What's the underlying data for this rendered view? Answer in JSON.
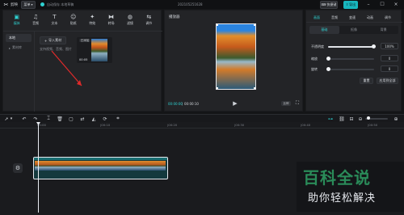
{
  "window": {
    "app_name": "剪映",
    "menu_label": "菜单",
    "autosave_text": "自动保存 本地草稿",
    "project_title": "202105251628",
    "export_label": "导出",
    "quick_label": "快捷键"
  },
  "toolbar": {
    "items": [
      {
        "label": "媒体",
        "icon": "media-icon",
        "active": true
      },
      {
        "label": "音频",
        "icon": "music-icon"
      },
      {
        "label": "文本",
        "icon": "text-icon"
      },
      {
        "label": "贴纸",
        "icon": "sticker-icon"
      },
      {
        "label": "特效",
        "icon": "effects-icon"
      },
      {
        "label": "转场",
        "icon": "transition-icon"
      },
      {
        "label": "滤镜",
        "icon": "filter-icon"
      },
      {
        "label": "调节",
        "icon": "adjust-icon"
      }
    ]
  },
  "media_sidebar": {
    "items": [
      {
        "label": "本地",
        "active": true
      },
      {
        "label": "素材库"
      }
    ]
  },
  "media_area": {
    "import_label": "导入素材",
    "hint_text": "支持视频、音频、图片",
    "thumb_badge": "已添加",
    "thumb_duration": "00:05"
  },
  "player": {
    "title": "播放器",
    "time_current": "00:00:00",
    "time_total": "00:00:10",
    "ratio_label": "比例",
    "fullscreen_icon": "fullscreen-icon"
  },
  "inspector": {
    "tabs": [
      {
        "label": "画面",
        "active": true
      },
      {
        "label": "音频"
      },
      {
        "label": "变速"
      },
      {
        "label": "动画"
      },
      {
        "label": "调节"
      }
    ],
    "subtabs": [
      {
        "label": "基础",
        "active": true
      },
      {
        "label": "抠像"
      },
      {
        "label": "背景"
      }
    ],
    "opacity": {
      "label": "不透明度",
      "value_text": "100%",
      "value": 1.0
    },
    "scale": {
      "label": "缩放",
      "value_text": "0",
      "value": 0.0
    },
    "rotate": {
      "label": "旋转",
      "value_text": "0",
      "value": 0.0
    },
    "reset_label": "重置",
    "apply_all_label": "应用到全部"
  },
  "timeline": {
    "ruler": [
      "00:00",
      "|00:10",
      "|00:20",
      "|00:30",
      "|00:40",
      "|00:50"
    ],
    "track_icon": "clip-settings-icon"
  },
  "watermark": {
    "line1": "百科全说",
    "line2": "助你轻松解决"
  }
}
